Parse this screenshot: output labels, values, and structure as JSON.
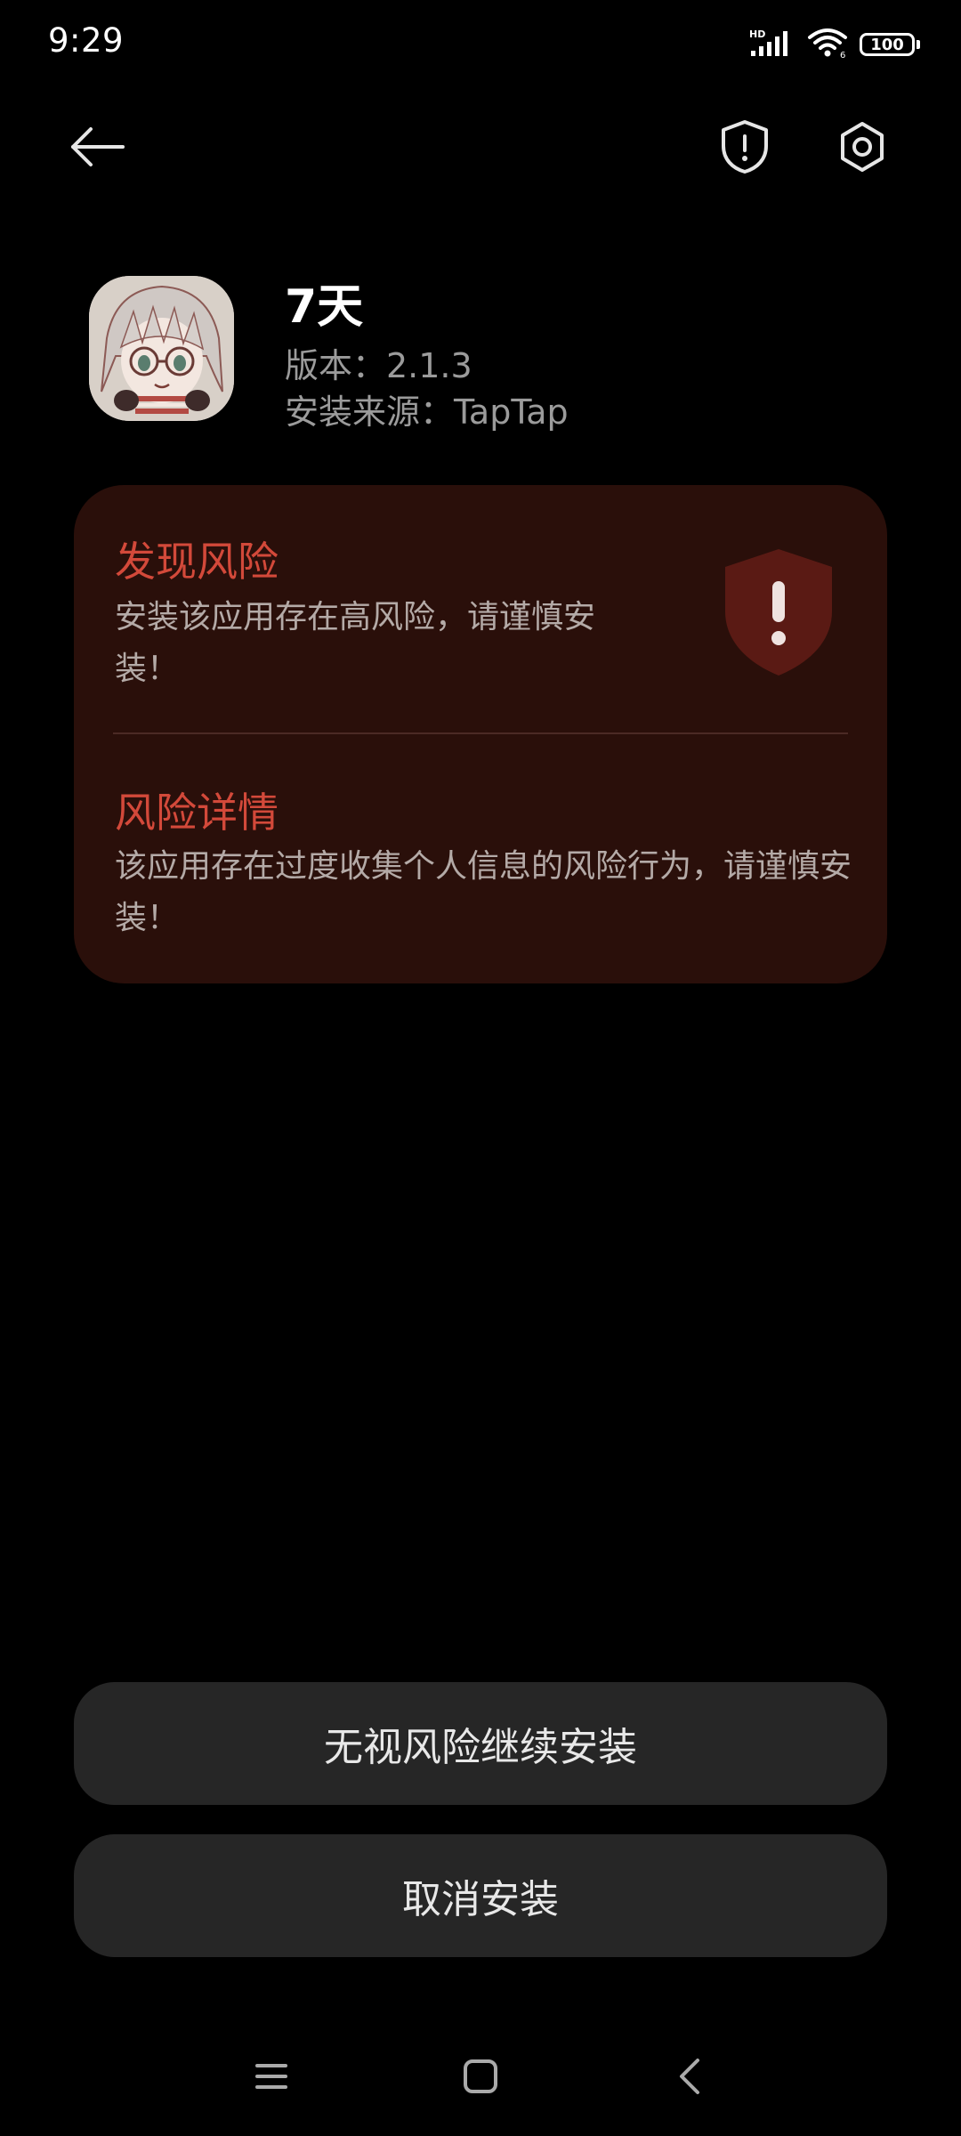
{
  "status_bar": {
    "time": "9:29",
    "battery_level": "100",
    "icons": [
      "hd-icon",
      "signal-icon",
      "wifi-icon",
      "battery-icon"
    ]
  },
  "topbar": {
    "icons": [
      "arrow-left-icon",
      "shield-alert-icon",
      "settings-icon"
    ]
  },
  "app": {
    "name": "7天",
    "version": "版本：2.1.3",
    "source": "安装来源：TapTap",
    "icon": "anime-avatar-icon"
  },
  "risk": {
    "title": "发现风险",
    "description": "安装该应用存在高风险，请谨慎安装！",
    "shield_icon": "shield-exclamation-icon",
    "detail_title": "风险详情",
    "detail_description": "该应用存在过度收集个人信息的风险行为，请谨慎安装！"
  },
  "buttons": {
    "continue_label": "无视风险继续安装",
    "cancel_label": "取消安装"
  },
  "nav": {
    "icons": [
      "menu-icon",
      "home-icon",
      "back-icon"
    ]
  },
  "colors": {
    "background": "#000000",
    "card": "#2a0f0a",
    "accent_red": "#d3493a",
    "button": "#262626"
  }
}
